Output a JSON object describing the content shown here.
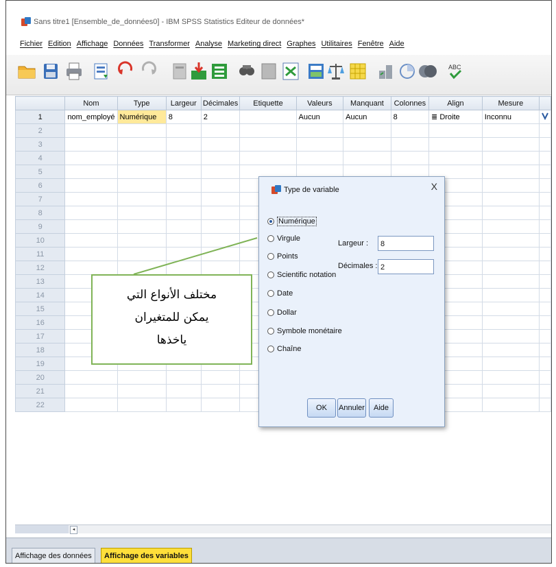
{
  "window": {
    "title": "Sans titre1 [Ensemble_de_données0] - IBM SPSS Statistics Editeur de données*"
  },
  "menu": [
    "Fichier",
    "Edition",
    "Affichage",
    "Données",
    "Transformer",
    "Analyse",
    "Marketing direct",
    "Graphes",
    "Utilitaires",
    "Fenêtre",
    "Aide"
  ],
  "toolbar": {
    "icons": [
      "open-folder-icon",
      "save-icon",
      "print-icon",
      "dialog-recall-icon",
      "undo-icon",
      "redo-icon",
      "goto-case-icon",
      "goto-variable-icon",
      "variables-icon",
      "find-icon",
      "insert-cases-icon",
      "insert-variable-icon",
      "split-file-icon",
      "weight-cases-icon",
      "select-cases-icon",
      "value-labels-icon",
      "use-sets-icon",
      "show-all-icon",
      "spell-check-icon"
    ],
    "spell_label": "ABC"
  },
  "grid": {
    "columns": [
      "Nom",
      "Type",
      "Largeur",
      "Décimales",
      "Etiquette",
      "Valeurs",
      "Manquant",
      "Colonnes",
      "Align",
      "Mesure",
      ""
    ],
    "row_numbers": [
      "1",
      "2",
      "3",
      "4",
      "5",
      "6",
      "7",
      "8",
      "9",
      "10",
      "11",
      "12",
      "13",
      "14",
      "15",
      "16",
      "17",
      "18",
      "19",
      "20",
      "21",
      "22"
    ],
    "row1": {
      "nom": "nom_employé",
      "type": "Numérique",
      "largeur": "8",
      "decimales": "2",
      "etiquette": "",
      "valeurs": "Aucun",
      "manquant": "Aucun",
      "colonnes": "8",
      "align": "Droite",
      "mesure": "Inconnu"
    }
  },
  "tabs": {
    "data_view": "Affichage des données",
    "variable_view": "Affichage des variables"
  },
  "dialog": {
    "title": "Type de variable",
    "close": "X",
    "options": [
      "Numérique",
      "Virgule",
      "Points",
      "Scientific notation",
      "Date",
      "Dollar",
      "Symbole monétaire",
      "Chaîne"
    ],
    "selected_index": 0,
    "largeur_label": "Largeur :",
    "largeur_value": "8",
    "decimales_label": "Décimales :",
    "decimales_value": "2",
    "ok": "OK",
    "annuler": "Annuler",
    "aide": "Aide"
  },
  "callout": {
    "line1": "مختلف الأنواع التي",
    "line2": "يمكن للمتغيران",
    "line3": "ياخذها"
  },
  "colors": {
    "type_cell_highlight": "#ffe99a",
    "active_tab": "#ffdf3a",
    "callout_border": "#7fb356",
    "dialog_bg": "#eaf1fb"
  }
}
